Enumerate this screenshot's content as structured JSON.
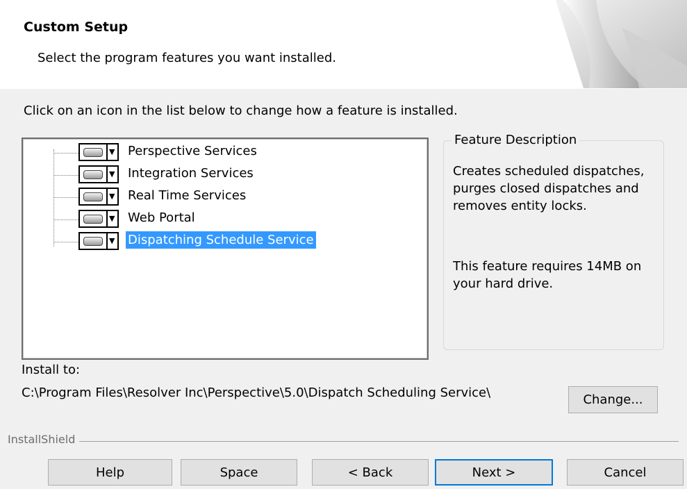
{
  "header": {
    "title": "Custom Setup",
    "subtitle": "Select the program features you want installed."
  },
  "instruction": "Click on an icon in the list below to change how a feature is installed.",
  "features": [
    {
      "label": "Perspective Services",
      "selected": false
    },
    {
      "label": "Integration Services",
      "selected": false
    },
    {
      "label": "Real Time Services",
      "selected": false
    },
    {
      "label": "Web Portal",
      "selected": false
    },
    {
      "label": "Dispatching Schedule Service",
      "selected": true
    }
  ],
  "description": {
    "legend": "Feature Description",
    "text": "Creates scheduled dispatches, purges closed dispatches and removes entity locks.",
    "size_text": "This feature requires 14MB on your hard drive."
  },
  "install": {
    "label": "Install to:",
    "path": "C:\\Program Files\\Resolver Inc\\Perspective\\5.0\\Dispatch Scheduling Service\\",
    "change_label": "Change..."
  },
  "brand": "InstallShield",
  "buttons": {
    "help": "Help",
    "space": "Space",
    "back": "< Back",
    "next": "Next >",
    "cancel": "Cancel"
  },
  "icons": {
    "feature": "hard-drive-dropdown-icon",
    "header": "page-curl-graphic"
  }
}
